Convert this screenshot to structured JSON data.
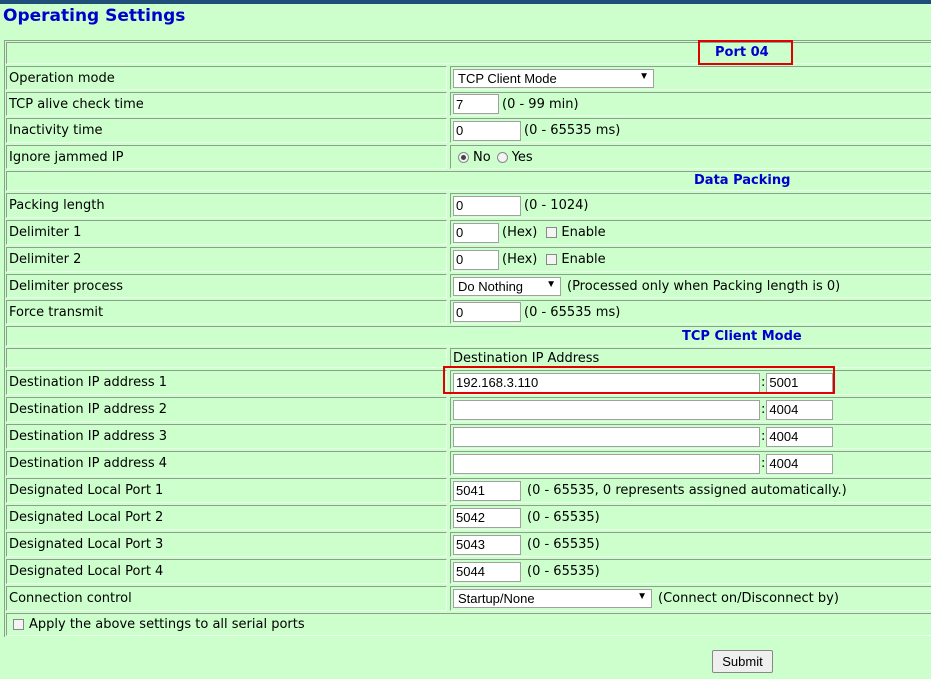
{
  "page_title": "Operating Settings",
  "sections": {
    "port": "Port 04",
    "data_packing": "Data Packing",
    "tcp_client_mode": "TCP Client Mode",
    "dest_ip_header": "Destination IP Address"
  },
  "operation_mode": {
    "label": "Operation mode",
    "value": "TCP Client Mode"
  },
  "tcp_alive": {
    "label": "TCP alive check time",
    "value": "7",
    "hint": "(0 - 99 min)"
  },
  "inactivity": {
    "label": "Inactivity time",
    "value": "0",
    "hint": "(0 - 65535 ms)"
  },
  "ignore_jammed": {
    "label": "Ignore jammed IP",
    "no": "No",
    "yes": "Yes",
    "selected": "No"
  },
  "packing_length": {
    "label": "Packing length",
    "value": "0",
    "hint": "(0 - 1024)"
  },
  "delimiter1": {
    "label": "Delimiter 1",
    "value": "0",
    "hex": "(Hex)",
    "enable": "Enable"
  },
  "delimiter2": {
    "label": "Delimiter 2",
    "value": "0",
    "hex": "(Hex)",
    "enable": "Enable"
  },
  "delimiter_process": {
    "label": "Delimiter process",
    "value": "Do Nothing",
    "hint": "(Processed only when Packing length is 0)"
  },
  "force_transmit": {
    "label": "Force transmit",
    "value": "0",
    "hint": "(0 - 65535 ms)"
  },
  "dest": [
    {
      "label": "Destination IP address 1",
      "ip": "192.168.3.110",
      "port": "5001"
    },
    {
      "label": "Destination IP address 2",
      "ip": "",
      "port": "4004"
    },
    {
      "label": "Destination IP address 3",
      "ip": "",
      "port": "4004"
    },
    {
      "label": "Destination IP address 4",
      "ip": "",
      "port": "4004"
    }
  ],
  "local_ports": [
    {
      "label": "Designated Local Port 1",
      "value": "5041",
      "hint": "(0 - 65535, 0 represents assigned automatically.)"
    },
    {
      "label": "Designated Local Port 2",
      "value": "5042",
      "hint": "(0 - 65535)"
    },
    {
      "label": "Designated Local Port 3",
      "value": "5043",
      "hint": "(0 - 65535)"
    },
    {
      "label": "Designated Local Port 4",
      "value": "5044",
      "hint": "(0 - 65535)"
    }
  ],
  "connection_control": {
    "label": "Connection control",
    "value": "Startup/None",
    "hint": "(Connect on/Disconnect by)"
  },
  "apply_all": "Apply the above settings to all serial ports",
  "submit": "Submit",
  "colon": ":"
}
